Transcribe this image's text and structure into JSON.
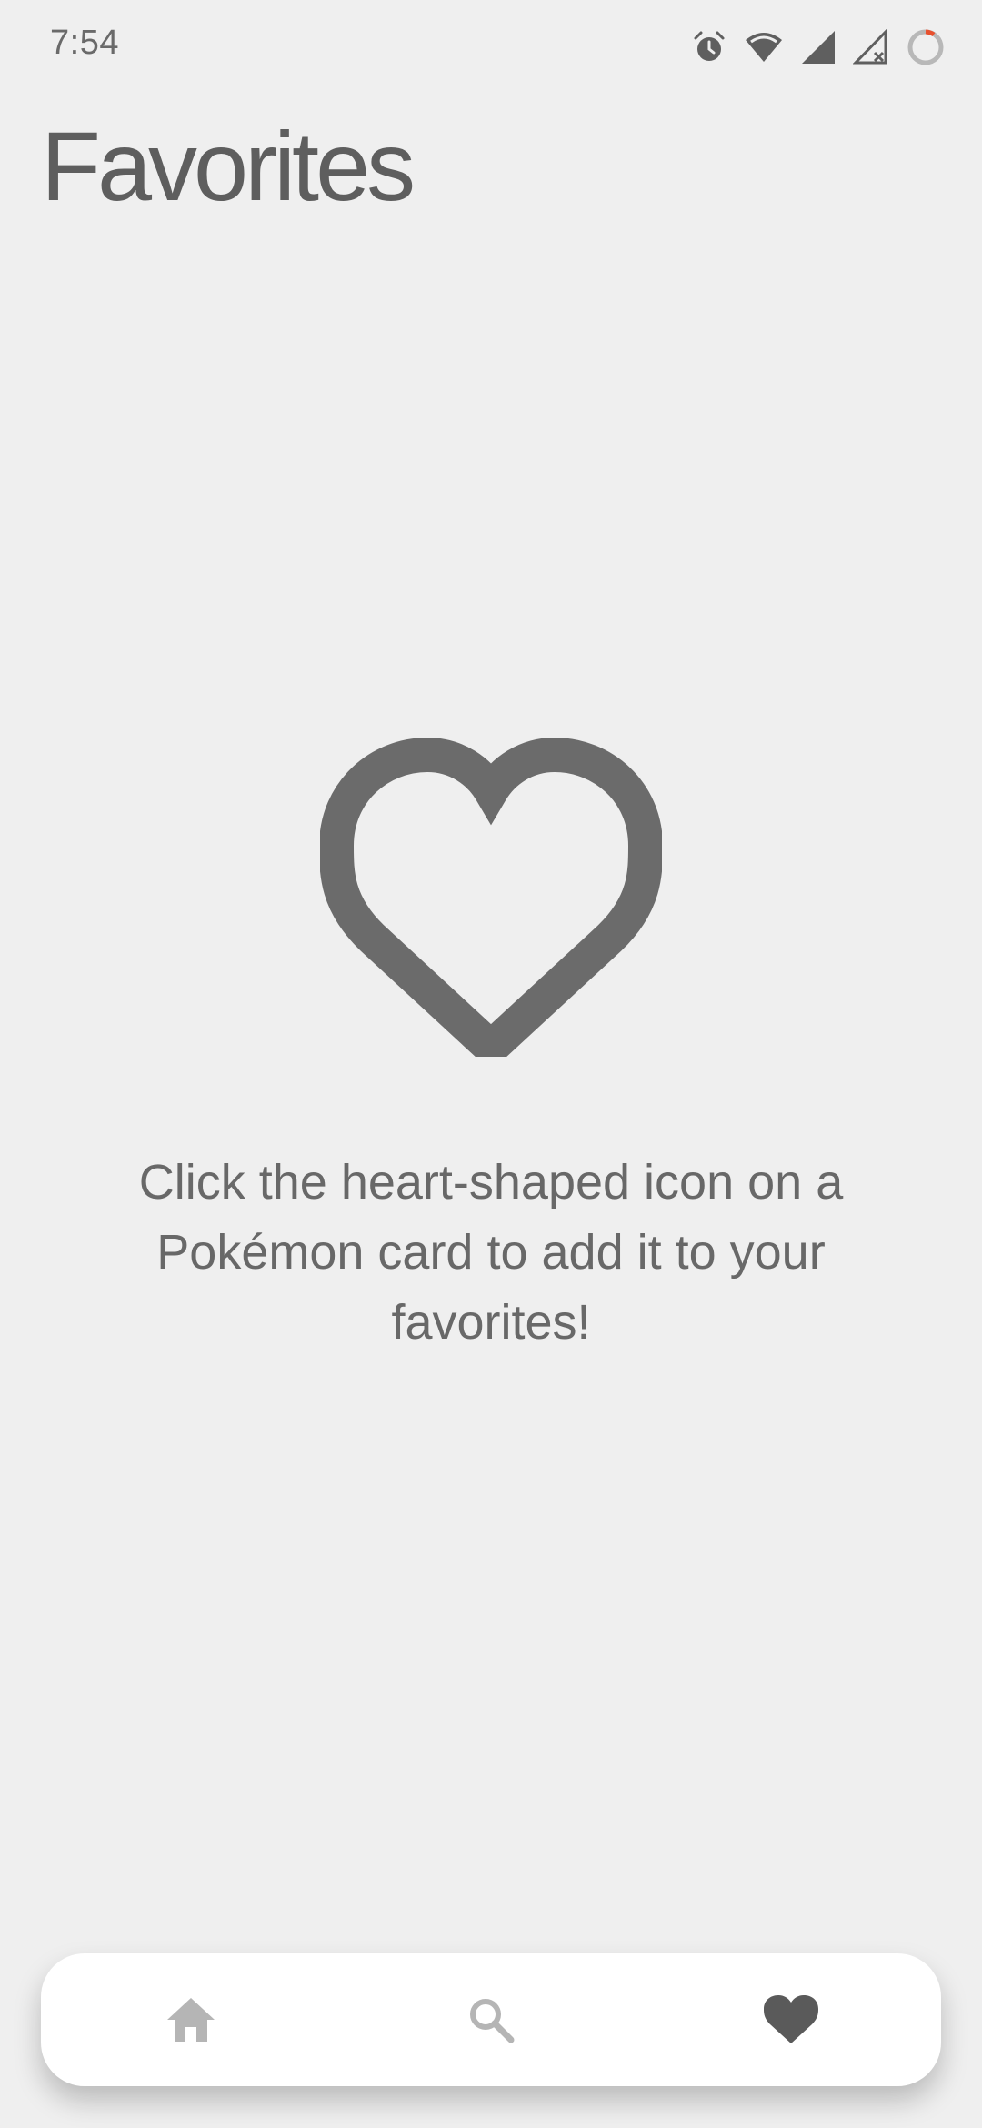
{
  "status_bar": {
    "time": "7:54",
    "icons": [
      "alarm-icon",
      "wifi-icon",
      "signal-icon",
      "signal-no-service-icon",
      "battery-charging-icon"
    ],
    "accent_color": "#e8512f"
  },
  "header": {
    "title": "Favorites"
  },
  "empty_state": {
    "icon": "heart-outline-icon",
    "message": "Click the heart-shaped icon on a Pokémon card to add it to your favorites!"
  },
  "bottom_nav": {
    "items": [
      {
        "icon": "home-icon",
        "active": false
      },
      {
        "icon": "search-icon",
        "active": false
      },
      {
        "icon": "heart-icon",
        "active": true
      }
    ],
    "active_color": "#5a5a5a",
    "inactive_color": "#b5b5b5"
  },
  "colors": {
    "background": "#efefef",
    "text": "#5f5f5f",
    "nav_background": "#ffffff"
  }
}
